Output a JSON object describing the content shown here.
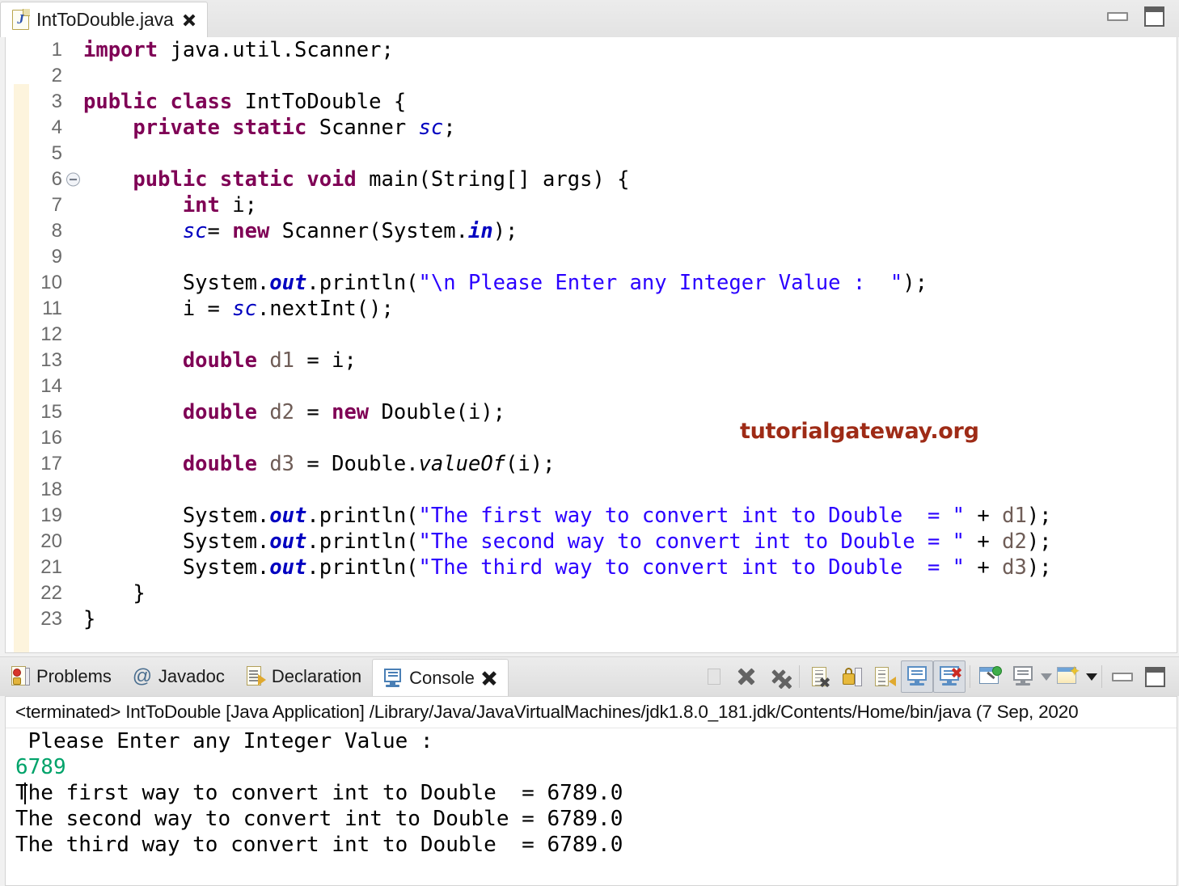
{
  "editor": {
    "tab": {
      "filename": "IntToDouble.java",
      "icon": "java-file-icon",
      "close_icon": "close-icon"
    },
    "window_buttons": {
      "minimize": "minimize-icon",
      "maximize": "maximize-icon"
    },
    "watermark": "tutorialgateway.org",
    "lines": [
      {
        "n": "1",
        "fold": false,
        "html": "<span class=\"kw\">import</span> java.util.Scanner;"
      },
      {
        "n": "2",
        "fold": false,
        "html": ""
      },
      {
        "n": "3",
        "fold": false,
        "html": "<span class=\"kw\">public class</span> IntToDouble {"
      },
      {
        "n": "4",
        "fold": false,
        "html": "    <span class=\"kw\">private static</span> Scanner <span class=\"fld2\">sc</span>;"
      },
      {
        "n": "5",
        "fold": false,
        "html": ""
      },
      {
        "n": "6",
        "fold": true,
        "html": "    <span class=\"kw\">public static void</span> main(String[] args) {"
      },
      {
        "n": "7",
        "fold": false,
        "html": "        <span class=\"kw\">int</span> i;"
      },
      {
        "n": "8",
        "fold": false,
        "html": "        <span class=\"fld2\">sc</span>= <span class=\"kw\">new</span> Scanner(System.<span class=\"fld\">in</span>);"
      },
      {
        "n": "9",
        "fold": false,
        "html": ""
      },
      {
        "n": "10",
        "fold": false,
        "html": "        System.<span class=\"fld\">out</span>.println(<span class=\"str\">\"\\n Please Enter any Integer Value :  \"</span>);"
      },
      {
        "n": "11",
        "fold": false,
        "html": "        i = <span class=\"fld2\">sc</span>.nextInt();"
      },
      {
        "n": "12",
        "fold": false,
        "html": ""
      },
      {
        "n": "13",
        "fold": false,
        "html": "        <span class=\"kw\">double</span> <span class=\"lv\">d1</span> = i;"
      },
      {
        "n": "14",
        "fold": false,
        "html": ""
      },
      {
        "n": "15",
        "fold": false,
        "html": "        <span class=\"kw\">double</span> <span class=\"lv\">d2</span> = <span class=\"kw\">new</span> Double(i);"
      },
      {
        "n": "16",
        "fold": false,
        "html": ""
      },
      {
        "n": "17",
        "fold": false,
        "html": "        <span class=\"kw\">double</span> <span class=\"lv\">d3</span> = Double.<span class=\"mth\">valueOf</span>(i);"
      },
      {
        "n": "18",
        "fold": false,
        "html": ""
      },
      {
        "n": "19",
        "fold": false,
        "html": "        System.<span class=\"fld\">out</span>.println(<span class=\"str\">\"The first way to convert int to Double  = \"</span> + <span class=\"lv\">d1</span>);"
      },
      {
        "n": "20",
        "fold": false,
        "html": "        System.<span class=\"fld\">out</span>.println(<span class=\"str\">\"The second way to convert int to Double = \"</span> + <span class=\"lv\">d2</span>);"
      },
      {
        "n": "21",
        "fold": false,
        "html": "        System.<span class=\"fld\">out</span>.println(<span class=\"str\">\"The third way to convert int to Double  = \"</span> + <span class=\"lv\">d3</span>);"
      },
      {
        "n": "22",
        "fold": false,
        "html": "    }"
      },
      {
        "n": "23",
        "fold": false,
        "html": "}"
      }
    ]
  },
  "console_view": {
    "tabs": [
      {
        "label": "Problems",
        "icon": "problems-icon",
        "active": false
      },
      {
        "label": "Javadoc",
        "icon": "javadoc-icon",
        "active": false
      },
      {
        "label": "Declaration",
        "icon": "declaration-icon",
        "active": false
      },
      {
        "label": "Console",
        "icon": "console-icon",
        "active": true
      }
    ],
    "toolbar": [
      {
        "name": "terminate-button",
        "icon": "stop-square-icon"
      },
      {
        "name": "remove-launch-button",
        "icon": "x-icon"
      },
      {
        "name": "remove-all-terminated-button",
        "icon": "double-x-icon"
      },
      {
        "name": "clear-console-button",
        "icon": "clear-console-icon"
      },
      {
        "name": "scroll-lock-button",
        "icon": "lock-icon"
      },
      {
        "name": "word-wrap-button",
        "icon": "word-wrap-icon"
      },
      {
        "name": "show-console-on-output-button",
        "icon": "show-console-icon"
      },
      {
        "name": "show-console-on-error-button",
        "icon": "show-console-error-icon"
      },
      {
        "name": "pin-console-button",
        "icon": "pin-icon"
      },
      {
        "name": "display-selected-console-button",
        "icon": "monitor-icon"
      },
      {
        "name": "open-console-button",
        "icon": "new-console-icon"
      },
      {
        "name": "minimize-view-button",
        "icon": "minimize-icon"
      },
      {
        "name": "maximize-view-button",
        "icon": "maximize-icon"
      }
    ],
    "status_line": "<terminated> IntToDouble [Java Application] /Library/Java/JavaVirtualMachines/jdk1.8.0_181.jdk/Contents/Home/bin/java  (7 Sep, 2020",
    "output": [
      {
        "text": " Please Enter any Integer Value : ",
        "kind": "stdout"
      },
      {
        "text": "6789",
        "kind": "stdin"
      },
      {
        "text": "The first way to convert int to Double  = 6789.0",
        "kind": "stdout"
      },
      {
        "text": "The second way to convert int to Double = 6789.0",
        "kind": "stdout"
      },
      {
        "text": "The third way to convert int to Double  = 6789.0",
        "kind": "stdout"
      }
    ]
  },
  "colors": {
    "keyword": "#7f0055",
    "string": "#2a00ff",
    "field": "#0000c0",
    "local_var": "#6f5d57",
    "stdin_green": "#00a36a",
    "watermark_red": "#9e2b16"
  }
}
